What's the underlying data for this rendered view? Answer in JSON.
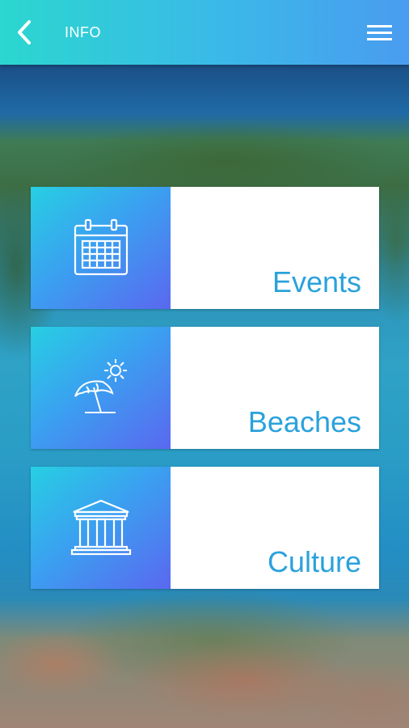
{
  "header": {
    "title": "INFO",
    "back_icon": "chevron-left-icon",
    "menu_icon": "hamburger-menu-icon"
  },
  "menu": {
    "items": [
      {
        "label": "Events",
        "icon": "calendar-icon"
      },
      {
        "label": "Beaches",
        "icon": "beach-umbrella-icon"
      },
      {
        "label": "Culture",
        "icon": "temple-icon"
      }
    ]
  },
  "colors": {
    "accent_text": "#2aa2dc",
    "header_gradient_start": "#2bd7cf",
    "header_gradient_end": "#4a9cf0",
    "tile_gradient_start": "#27cfe3",
    "tile_gradient_end": "#5a68f0"
  }
}
